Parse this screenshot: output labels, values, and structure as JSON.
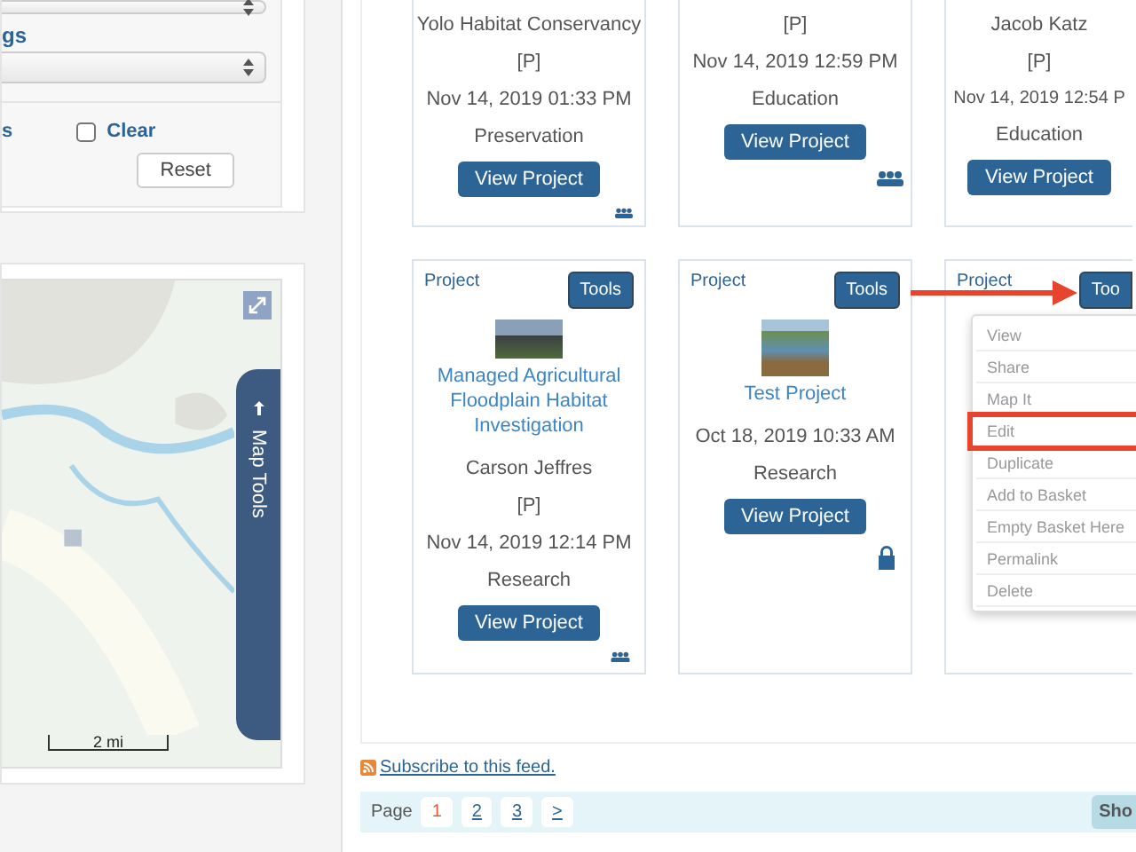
{
  "filters": {
    "label": "gs",
    "link": "s",
    "clear": {
      "label": "Clear",
      "checked": false
    },
    "reset": "Reset"
  },
  "map": {
    "tools_label": "Map Tools",
    "scale": "2 mi"
  },
  "cards_top": [
    {
      "author": "Yolo Habitat Conservancy",
      "visibility": "[P]",
      "date": "Nov 14, 2019 01:33 PM",
      "category": "Preservation",
      "button": "View Project",
      "shared": true
    },
    {
      "visibility": "[P]",
      "date": "Nov 14, 2019 12:59 PM",
      "category": "Education",
      "button": "View Project",
      "shared": true
    },
    {
      "author": "Jacob Katz",
      "visibility": "[P]",
      "date": "Nov 14, 2019 12:54 P",
      "category": "Education",
      "button": "View Project",
      "shared": false
    }
  ],
  "cards": [
    {
      "type_label": "Project",
      "tools": "Tools",
      "photo": true,
      "title": "Managed Agricultural Floodplain Habitat Investigation",
      "author": "Carson Jeffres",
      "visibility": "[P]",
      "date": "Nov 14, 2019 12:14 PM",
      "category": "Research",
      "button": "View Project",
      "shared": true,
      "locked": false
    },
    {
      "type_label": "Project",
      "tools": "Tools",
      "photo": true,
      "title": "Test Project",
      "date": "Oct 18, 2019 10:33 AM",
      "category": "Research",
      "button": "View Project",
      "shared": false,
      "locked": true
    },
    {
      "type_label": "Project",
      "tools": "Too",
      "menu": [
        "View",
        "Share",
        "Map It",
        "Edit",
        "Duplicate",
        "Add to Basket",
        "Empty Basket Here",
        "Permalink",
        "Delete"
      ]
    }
  ],
  "subscribe": "Subscribe to this feed.",
  "pagination": {
    "label": "Page",
    "pages": [
      {
        "label": "1",
        "selected": true
      },
      {
        "label": "2",
        "selected": false
      },
      {
        "label": "3",
        "selected": false
      },
      {
        "label": ">",
        "selected": false
      }
    ],
    "show": "Sho"
  }
}
